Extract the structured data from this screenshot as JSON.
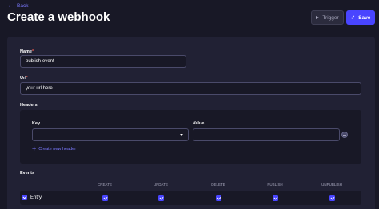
{
  "header": {
    "back_label": "Back",
    "back_icon": "arrow-left-icon",
    "title": "Create a webhook",
    "trigger_label": "Trigger",
    "trigger_icon": "play-icon",
    "save_label": "Save",
    "save_icon": "check-icon"
  },
  "form": {
    "name_label": "Name",
    "name_value": "publish-event",
    "url_label": "Url",
    "url_placeholder": "your url here",
    "headers_label": "Headers",
    "key_label": "Key",
    "key_value": "",
    "value_label": "Value",
    "value_value": "",
    "add_header_label": "Create new header",
    "required_marker": "*"
  },
  "events": {
    "label": "Events",
    "columns": [
      "CREATE",
      "UPDATE",
      "DELETE",
      "PUBLISH",
      "UNPUBLISH"
    ],
    "rows": [
      {
        "label": "Entry",
        "checked": [
          true,
          true,
          true,
          true,
          true
        ],
        "all_checked": true
      }
    ]
  },
  "colors": {
    "background": "#181826",
    "card": "#212134",
    "accent": "#4945ff",
    "link": "#7b79ff",
    "required": "#ee5e52"
  }
}
